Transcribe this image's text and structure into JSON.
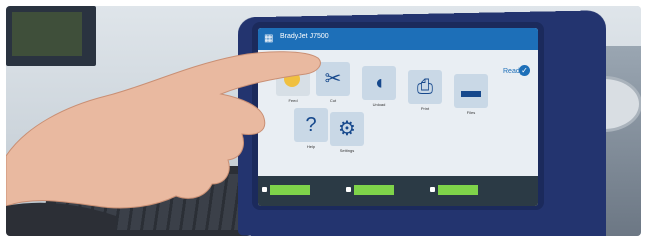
{
  "screen": {
    "title": "BradyJet J7500",
    "status": "Ready"
  },
  "tiles": [
    {
      "label": "Feed",
      "icon": "feed-icon"
    },
    {
      "label": "Cut",
      "icon": "scissors-icon"
    },
    {
      "label": "Unload",
      "icon": "unload-icon"
    },
    {
      "label": "Print",
      "icon": "printer-icon"
    },
    {
      "label": "Files",
      "icon": "folder-icon"
    },
    {
      "label": "Help",
      "icon": "help-icon"
    },
    {
      "label": "Settings",
      "icon": "gear-icon"
    }
  ],
  "colors": {
    "device_body": "#23346f",
    "titlebar": "#1d6fb8",
    "status_green": "#7fd34a"
  }
}
